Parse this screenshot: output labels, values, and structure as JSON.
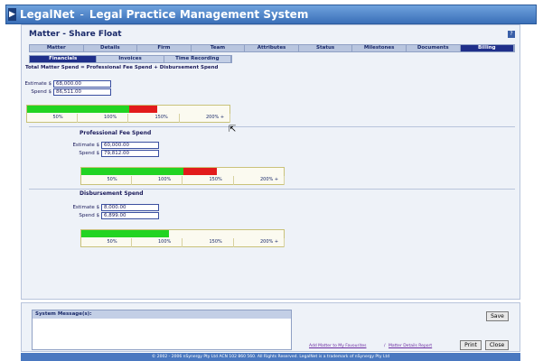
{
  "window": {
    "app_name": "LegalNet",
    "title_sep": "-",
    "title": "Legal Practice Management System"
  },
  "page": {
    "title": "Matter - Share Float",
    "help": "?"
  },
  "tabs": [
    "Matter",
    "Details",
    "Firm",
    "Team",
    "Attributes",
    "Status",
    "Milestones",
    "Documents",
    "Billing"
  ],
  "subtabs": [
    "Financials",
    "Invoices",
    "Time Recording"
  ],
  "total": {
    "label": "Total Matter Spend = Professional Fee Spend + Disbursement Spend",
    "estimate_label": "Estimate $",
    "estimate_value": "68,000.00",
    "spend_label": "Spend $",
    "spend_value": "86,511.00",
    "progress_percent": 127
  },
  "professional": {
    "label": "Professional Fee Spend",
    "estimate_label": "Estimate $",
    "estimate_value": "60,000.00",
    "spend_label": "Spend $",
    "spend_value": "79,812.00",
    "progress_percent": 133
  },
  "disbursement": {
    "label": "Disbursement Spend",
    "estimate_label": "Estimate $",
    "estimate_value": "8,000.00",
    "spend_label": "Spend $",
    "spend_value": "6,899.00",
    "progress_percent": 86
  },
  "scale_ticks": [
    "50%",
    "100%",
    "150%",
    "200% +"
  ],
  "system_message": {
    "label": "System Message(s):"
  },
  "footer": {
    "save": "Save",
    "print": "Print",
    "close": "Close",
    "favourites_link": "Add Matter to My Favourites",
    "link_sep": "/",
    "report_link": "Matter Details Report",
    "copyright": "© 2002 - 2006 nSynergy Pty Ltd ACN 102 860 560. All Rights Reserved. LegalNet is a trademark of nSynergy Pty Ltd"
  },
  "colors": {
    "under_budget": "#22d422",
    "over_budget": "#e21b1b",
    "active_tab": "#1f2f8a"
  }
}
